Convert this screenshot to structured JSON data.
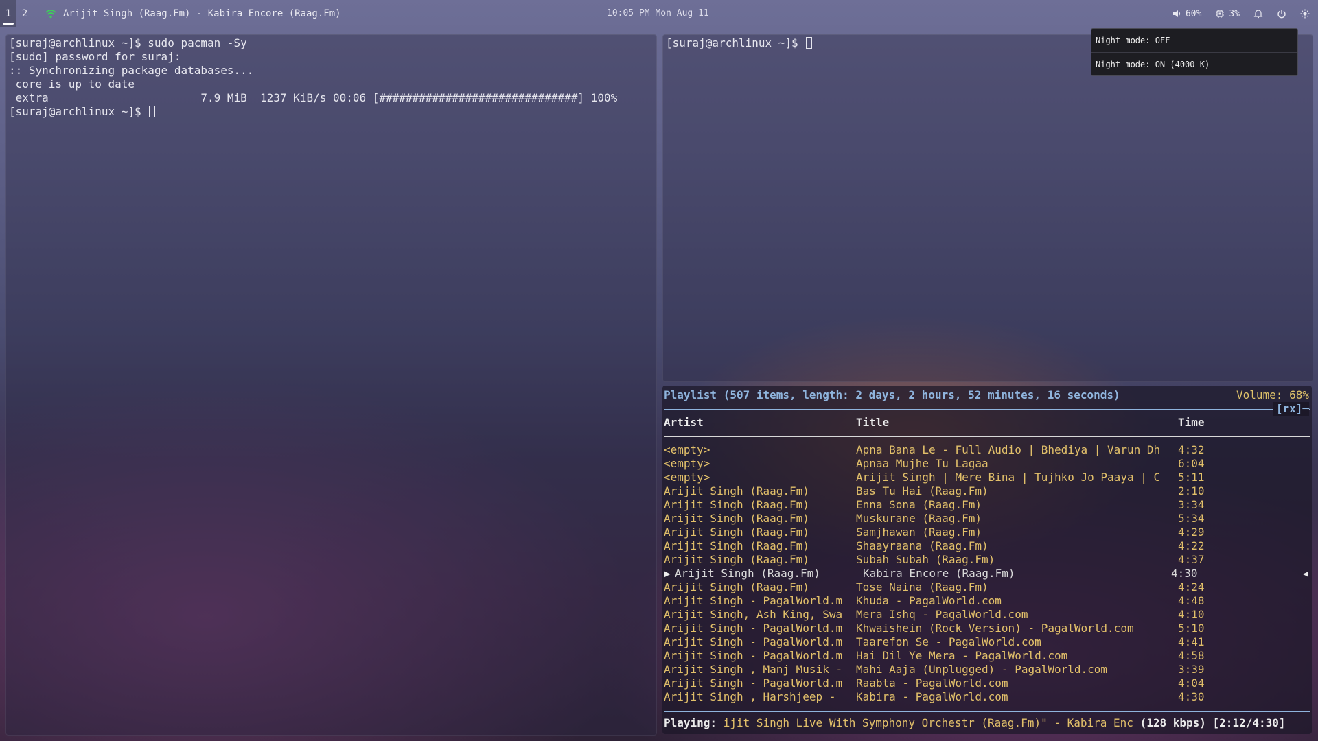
{
  "topbar": {
    "workspaces": [
      "1",
      "2"
    ],
    "window_title": "Arijit Singh (Raag.Fm) - Kabira Encore (Raag.Fm)",
    "clock": "10:05 PM Mon Aug 11",
    "volume": "60%",
    "cpu": "3%",
    "colors": {
      "wifi": "#3ecf5a"
    }
  },
  "term_left": {
    "lines": [
      "[suraj@archlinux ~]$ sudo pacman -Sy",
      "[sudo] password for suraj:",
      ":: Synchronizing package databases...",
      " core is up to date",
      " extra                       7.9 MiB  1237 KiB/s 00:06 [##############################] 100%"
    ],
    "prompt": "[suraj@archlinux ~]$ "
  },
  "term_right": {
    "prompt": "[suraj@archlinux ~]$ "
  },
  "night_popup": {
    "off": "Night mode: OFF",
    "on": "Night mode: ON (4000 K)"
  },
  "ncmpcpp": {
    "header": "Playlist (507 items, length: 2 days, 2 hours, 52 minutes, 16 seconds)",
    "volume": "Volume: 68%",
    "flags": "[rx]─",
    "columns": {
      "artist": "Artist",
      "title": "Title",
      "time": "Time"
    },
    "rows": [
      {
        "artist": "<empty>",
        "title": "Apna Bana Le - Full Audio | Bhediya | Varun Dh",
        "time": "4:32"
      },
      {
        "artist": "<empty>",
        "title": "Apnaa Mujhe Tu Lagaa",
        "time": "6:04"
      },
      {
        "artist": "<empty>",
        "title": "Arijit Singh | Mere Bina | Tujhko Jo Paaya | C",
        "time": "5:11"
      },
      {
        "artist": "Arijit Singh (Raag.Fm)",
        "title": "Bas Tu Hai (Raag.Fm)",
        "time": "2:10"
      },
      {
        "artist": "Arijit Singh (Raag.Fm)",
        "title": "Enna Sona (Raag.Fm)",
        "time": "3:34"
      },
      {
        "artist": "Arijit Singh (Raag.Fm)",
        "title": "Muskurane (Raag.Fm)",
        "time": "5:34"
      },
      {
        "artist": "Arijit Singh (Raag.Fm)",
        "title": "Samjhawan (Raag.Fm)",
        "time": "4:29"
      },
      {
        "artist": "Arijit Singh (Raag.Fm)",
        "title": "Shaayraana (Raag.Fm)",
        "time": "4:22"
      },
      {
        "artist": "Arijit Singh (Raag.Fm)",
        "title": "Subah Subah (Raag.Fm)",
        "time": "4:37"
      },
      {
        "artist": "Arijit Singh (Raag.Fm)",
        "title": "Kabira Encore (Raag.Fm)",
        "time": "4:30",
        "current": true
      },
      {
        "artist": "Arijit Singh (Raag.Fm)",
        "title": "Tose Naina (Raag.Fm)",
        "time": "4:24"
      },
      {
        "artist": "Arijit Singh - PagalWorld.m",
        "title": "Khuda - PagalWorld.com",
        "time": "4:48"
      },
      {
        "artist": "Arijit Singh, Ash King, Swa",
        "title": "Mera Ishq - PagalWorld.com",
        "time": "4:10"
      },
      {
        "artist": "Arijit Singh - PagalWorld.m",
        "title": "Khwaishein (Rock Version) - PagalWorld.com",
        "time": "5:10"
      },
      {
        "artist": "Arijit Singh - PagalWorld.m",
        "title": "Taarefon Se - PagalWorld.com",
        "time": "4:41"
      },
      {
        "artist": "Arijit Singh - PagalWorld.m",
        "title": "Hai Dil Ye Mera - PagalWorld.com",
        "time": "4:58"
      },
      {
        "artist": "Arijit Singh , Manj Musik -",
        "title": "Mahi Aaja (Unplugged) - PagalWorld.com",
        "time": "3:39"
      },
      {
        "artist": "Arijit Singh - PagalWorld.m",
        "title": "Raabta - PagalWorld.com",
        "time": "4:04"
      },
      {
        "artist": "Arijit Singh , Harshjeep -",
        "title": "Kabira - PagalWorld.com",
        "time": "4:30"
      }
    ],
    "current_marker": "▶",
    "current_right_marker": "◀",
    "status_label": "Playing:",
    "status_track": " ijit Singh Live With Symphony Orchestr (Raag.Fm)\" - Kabira Enc ",
    "status_bitrate": "(128 kbps)",
    "status_time": "[2:12/4:30]"
  }
}
